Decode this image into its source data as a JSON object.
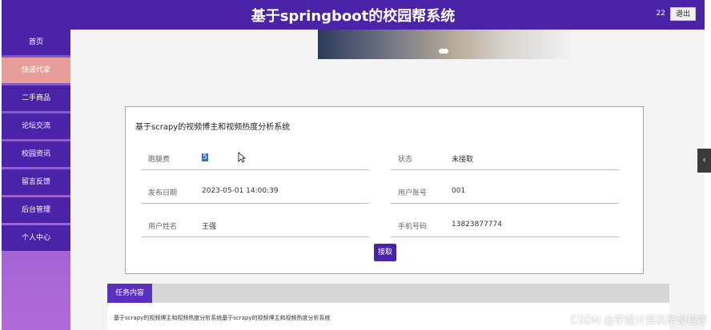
{
  "header": {
    "title": "基于springboot的校园帮系统",
    "user_count": "22",
    "logout_label": "退出"
  },
  "sidebar": {
    "items": [
      {
        "label": "首页"
      },
      {
        "label": "快递代拿",
        "active": true
      },
      {
        "label": "二手商品"
      },
      {
        "label": "论坛交流"
      },
      {
        "label": "校园资讯"
      },
      {
        "label": "留言反馈"
      },
      {
        "label": "后台管理"
      },
      {
        "label": "个人中心"
      }
    ]
  },
  "detail": {
    "title": "基于scrapy的视频博主和视频热度分析系统",
    "fields": {
      "fee": {
        "label": "跑腿费",
        "value": "5"
      },
      "status": {
        "label": "状态",
        "value": "未接取"
      },
      "publish_date": {
        "label": "发布日期",
        "value": "2023-05-01 14:00:39"
      },
      "account": {
        "label": "用户账号",
        "value": "001"
      },
      "username": {
        "label": "用户姓名",
        "value": "王强"
      },
      "phone": {
        "label": "手机号码",
        "value": "13823877774"
      }
    },
    "take_button": "接取"
  },
  "task": {
    "tab_label": "任务内容",
    "content": "基于scrapy的视频博主和视频热度分析系统基于scrapy的视频博主和视频热度分析系统"
  },
  "side_handle_icon": "chevron-left-icon",
  "watermark": "CSDN @学姐计算机毕设程序",
  "colors": {
    "primary": "#4a23a9",
    "active_nav": "#e79e9a",
    "selection": "#2f6fd6"
  }
}
